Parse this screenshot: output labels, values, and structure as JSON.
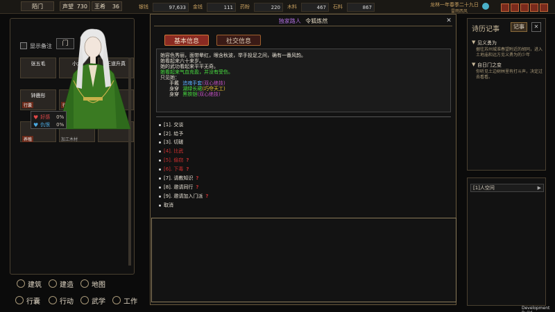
{
  "topbar": {
    "sect_label": "陌门",
    "reputation_label": "声望",
    "reputation_value": "730",
    "sect_size_label": "王希",
    "sect_size_value": "36",
    "resources": [
      {
        "label": "银钱",
        "value": "97,633"
      },
      {
        "label": "金钱",
        "value": "111"
      },
      {
        "label": "药粉",
        "value": "220"
      },
      {
        "label": "木料",
        "value": "467"
      },
      {
        "label": "石料",
        "value": "867"
      }
    ],
    "date_text": "龙林一年春季二十九日",
    "weather_text": "雷雨西风"
  },
  "left_panel": {
    "checkbox_label": "显示备注",
    "tab_label": "门",
    "cards": [
      {
        "name": "张五毛",
        "tag": "",
        "sub": ""
      },
      {
        "name": "小龙",
        "tag": "",
        "sub": ""
      },
      {
        "name": "王道升真",
        "tag": "",
        "sub": ""
      },
      {
        "name": "钟鹿彤",
        "tag": "行囊",
        "sub": ""
      },
      {
        "name": "",
        "tag": "行囊",
        "sub": ""
      },
      {
        "name": "",
        "tag": "",
        "sub": ""
      },
      {
        "name": "",
        "tag": "养殖",
        "sub": "加工木材"
      },
      {
        "name": "",
        "tag": "",
        "sub": ""
      },
      {
        "name": "",
        "tag": "",
        "sub": ""
      }
    ],
    "status": [
      {
        "label": "好感",
        "value": "0%",
        "color": "#e04848"
      },
      {
        "label": "仇恨",
        "value": "0%",
        "color": "#4aa8e0"
      }
    ]
  },
  "bottom_nav": {
    "row1": [
      "建筑",
      "建造",
      "地图"
    ],
    "row2": [
      "行囊",
      "行动",
      "武学",
      "工作"
    ]
  },
  "dialog": {
    "header_prefix": "独家路人",
    "header_name": "令狐炼然",
    "tab_basic": "基本信息",
    "tab_social": "社交信息",
    "description": [
      "她容色秀丽，面带晕红，眼含秋波，举手投足之间，确有一番风韵。",
      "她看起来六十来岁。",
      "她的武功看起来平平无奇。",
      "她看起来气血充盈，并没有受伤。",
      "只见她："
    ],
    "equipment": [
      {
        "slot": "手戴",
        "item": "追魂手套",
        "note": "(双心绝技)"
      },
      {
        "slot": "身穿",
        "item": "湖绿长裙",
        "note": "(巧夺天工)"
      },
      {
        "slot": "身穿",
        "item": "黑铁铠",
        "note": "(双心绝技)"
      }
    ],
    "options": [
      {
        "text": "[1]. 交谈",
        "mark": "",
        "red": false
      },
      {
        "text": "[2]. 给予",
        "mark": "",
        "red": false
      },
      {
        "text": "[3]. 切磋",
        "mark": "",
        "red": false
      },
      {
        "text": "[4]. 比武",
        "mark": "",
        "red": true
      },
      {
        "text": "[5]. 偷窃",
        "mark": "?",
        "red": true
      },
      {
        "text": "[6]. 下毒",
        "mark": "?",
        "red": true
      },
      {
        "text": "[7]. 请教知识",
        "mark": "?",
        "red": false
      },
      {
        "text": "[8]. 邀请同行",
        "mark": "?",
        "red": false
      },
      {
        "text": "[9]. 邀请加入门派",
        "mark": "?",
        "red": false
      },
      {
        "text": "取消",
        "mark": "",
        "red": false
      }
    ]
  },
  "right_panel": {
    "title": "诗历记事",
    "tab": "记事",
    "entries": [
      {
        "head": "见义勇为",
        "body": "据往苏州城淮春望附近的胡同，进入土地庙和远方见义勇为的少年"
      },
      {
        "head": "自日门之变",
        "body": "你听见土边树林里有打斗声，决定过去看看。"
      }
    ],
    "lower_item": "[1]人空间"
  },
  "footer": {
    "build": "Development Build"
  }
}
